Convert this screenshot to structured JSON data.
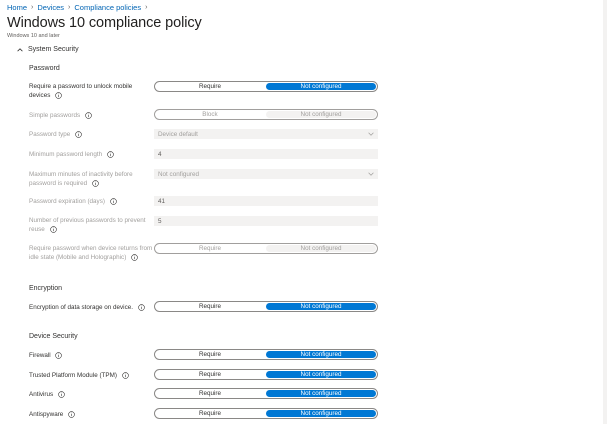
{
  "breadcrumb": {
    "items": [
      "Home",
      "Devices",
      "Compliance policies"
    ]
  },
  "page": {
    "title": "Windows 10 compliance policy",
    "subtitle": "Windows 10 and later"
  },
  "section": {
    "title": "System Security"
  },
  "groups": {
    "password": "Password",
    "encryption": "Encryption",
    "device_security": "Device Security"
  },
  "toggle_labels": {
    "require": "Require",
    "block": "Block",
    "not_configured": "Not configured"
  },
  "settings": {
    "require_password": {
      "label": "Require a password to unlock mobile devices",
      "selected": "Not configured"
    },
    "simple_passwords": {
      "label": "Simple passwords",
      "selected": "Not configured"
    },
    "password_type": {
      "label": "Password type",
      "value": "Device default"
    },
    "min_password_length": {
      "label": "Minimum password length",
      "value": "4"
    },
    "max_inactivity": {
      "label": "Maximum minutes of inactivity before password is required",
      "value": "Not configured"
    },
    "password_expiration": {
      "label": "Password expiration (days)",
      "value": "41"
    },
    "previous_passwords": {
      "label": "Number of previous passwords to prevent reuse",
      "value": "5"
    },
    "require_on_idle": {
      "label": "Require password when device returns from idle state (Mobile and Holographic)",
      "selected": "Not configured"
    },
    "encryption_storage": {
      "label": "Encryption of data storage on device.",
      "selected": "Not configured"
    },
    "firewall": {
      "label": "Firewall",
      "selected": "Not configured"
    },
    "tpm": {
      "label": "Trusted Platform Module (TPM)",
      "selected": "Not configured"
    },
    "antivirus": {
      "label": "Antivirus",
      "selected": "Not configured"
    },
    "antispyware": {
      "label": "Antispyware",
      "selected": "Not configured"
    }
  },
  "colors": {
    "accent": "#0078d4",
    "link": "#0064b4",
    "disabled": "#a19f9d"
  }
}
